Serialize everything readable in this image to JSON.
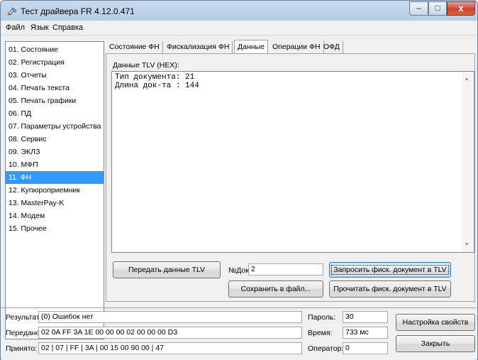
{
  "window": {
    "title": "Тест драйвера FR 4.12.0.471",
    "close_glyph": "x",
    "min_glyph": "–",
    "max_glyph": "□"
  },
  "menu": [
    "Файл",
    "Язык",
    "Справка"
  ],
  "sidebar": {
    "selected_index": 10,
    "items": [
      {
        "label": "01. Состояние"
      },
      {
        "label": "02. Регистрация"
      },
      {
        "label": "03. Отчеты"
      },
      {
        "label": "04. Печать текста"
      },
      {
        "label": "05. Печать графики"
      },
      {
        "label": "06. ПД"
      },
      {
        "label": "07. Параметры устройства"
      },
      {
        "label": "08. Сервис"
      },
      {
        "label": "09. ЭКЛЗ"
      },
      {
        "label": "10. МФП"
      },
      {
        "label": "11. ФН"
      },
      {
        "label": "12. Купюроприемник"
      },
      {
        "label": "13. MasterPay-K"
      },
      {
        "label": "14. Модем"
      },
      {
        "label": "15. Прочее"
      }
    ]
  },
  "tabs": [
    {
      "label": "Состояние ФН"
    },
    {
      "label": "Фискализация ФН"
    },
    {
      "label": "Данные",
      "active": true
    },
    {
      "label": "Операции ФН"
    },
    {
      "label": "ОФД"
    }
  ],
  "data_tab": {
    "tlv_label": "Данные TLV (HEX):",
    "lines": [
      "Тип документа: 21",
      "Длина док-та : 144"
    ],
    "send_tlv_button": "Передать данные TLV",
    "doc_no_label": "№Док.",
    "doc_no_value": "2",
    "request_doc_button": "Запросить фиск. документ в TLV",
    "save_file_button": "Сохранить в файл...",
    "read_doc_button": "Прочитать фиск. документ в TLV"
  },
  "status": {
    "result_label": "Результат:",
    "result_value": "(0) Ошибок нет",
    "sent_label": "Передано:",
    "sent_value": "02 0A FF 3A 1E 00 00 00 02 00 00 00 D3",
    "received_label": "Принято:",
    "received_value": "02 | 07 | FF | 3A | 00 15 00 90 00 | 47",
    "password_label": "Пароль:",
    "password_value": "30",
    "time_label": "Время:",
    "time_value": "733 мс",
    "operator_label": "Оператор:",
    "operator_value": "0",
    "settings_button": "Настройка свойств",
    "close_button": "Закрыть"
  },
  "colors": {
    "selection": "#3399ff",
    "titlebar": "#b7cce6",
    "close": "#c7452f"
  }
}
